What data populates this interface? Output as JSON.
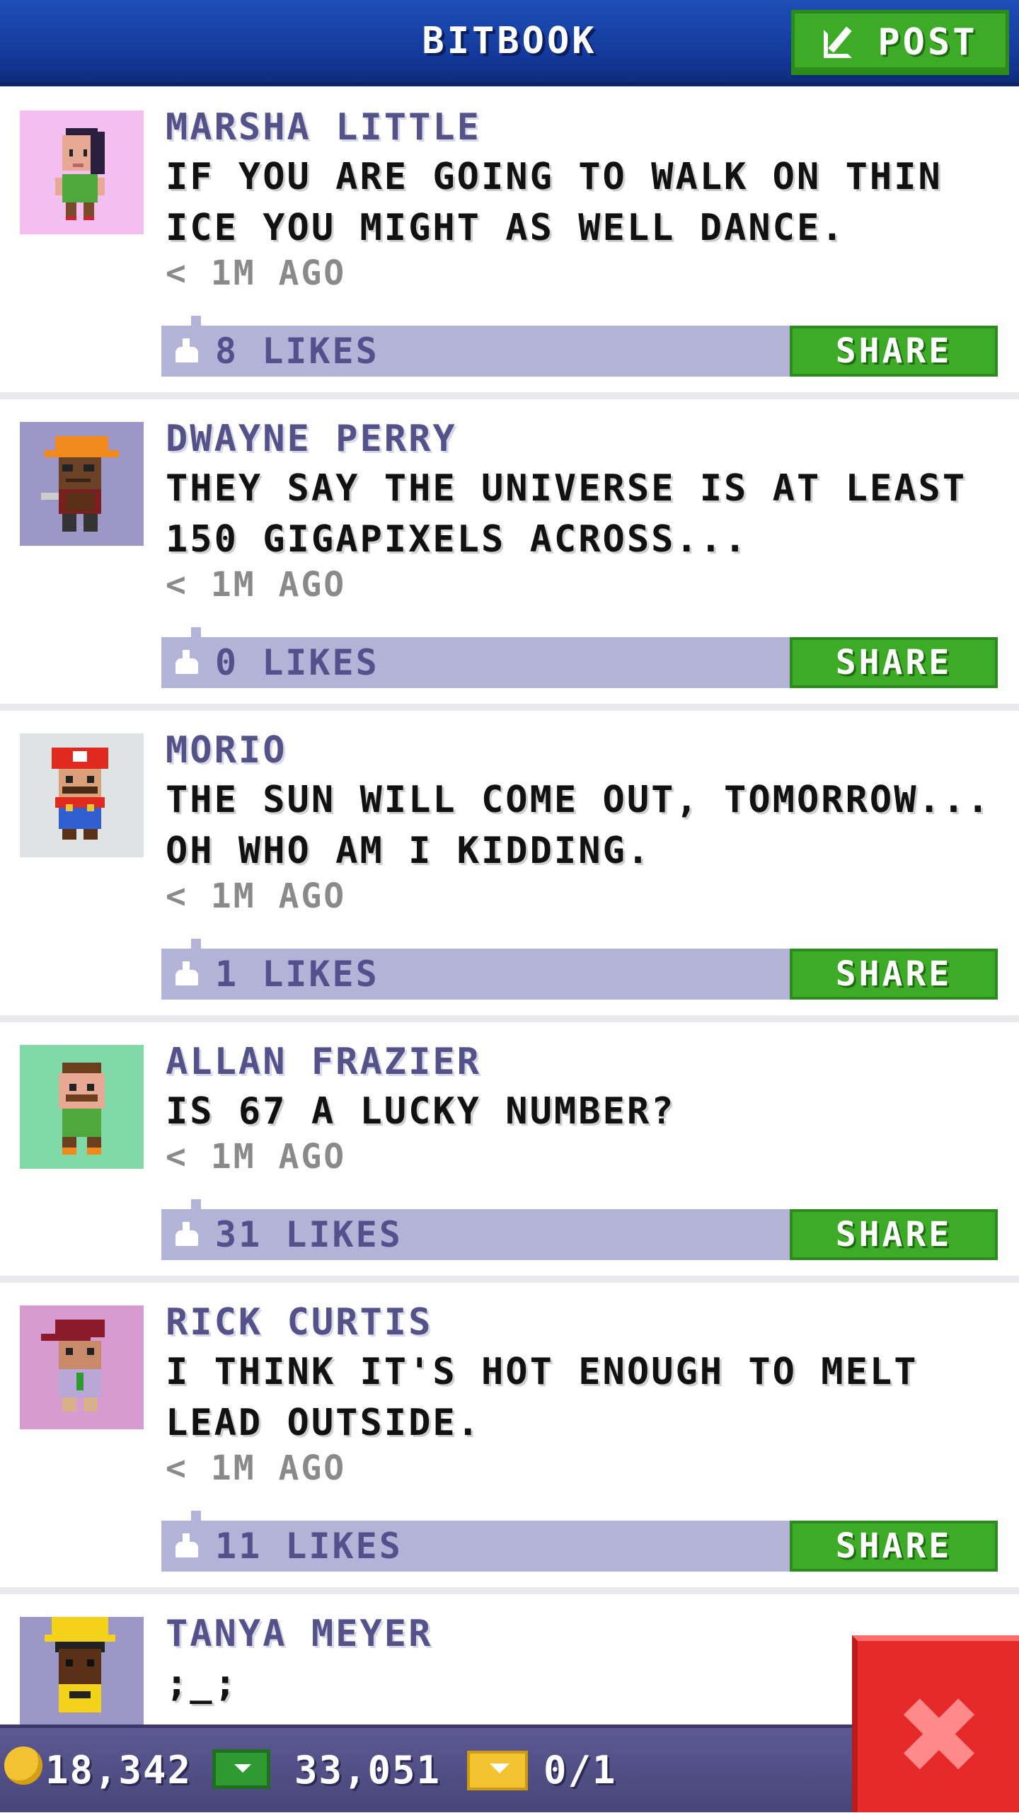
{
  "app": {
    "title": "BITBOOK",
    "post_label": "POST"
  },
  "posts": [
    {
      "name": "MARSHA LITTLE",
      "message": "IF YOU ARE GOING TO WALK ON THIN ICE YOU MIGHT AS WELL DANCE.",
      "time": "< 1M AGO",
      "likes": "8 LIKES",
      "share": "SHARE",
      "avatar_bg": "#f2bff0",
      "avatar": "woman-green-shirt"
    },
    {
      "name": "DWAYNE PERRY",
      "message": "THEY SAY THE UNIVERSE IS AT LEAST 150 GIGAPIXELS ACROSS...",
      "time": "< 1M AGO",
      "likes": "0 LIKES",
      "share": "SHARE",
      "avatar_bg": "#9d97c7",
      "avatar": "construction-worker"
    },
    {
      "name": "MORIO",
      "message": "THE SUN WILL COME OUT, TOMORROW... OH WHO AM I KIDDING.",
      "time": "< 1M AGO",
      "likes": "1 LIKES",
      "share": "SHARE",
      "avatar_bg": "#dfe3e4",
      "avatar": "plumber-red-cap"
    },
    {
      "name": "ALLAN FRAZIER",
      "message": "IS 67 A LUCKY NUMBER?",
      "time": "< 1M AGO",
      "likes": "31 LIKES",
      "share": "SHARE",
      "avatar_bg": "#80d9a6",
      "avatar": "man-mustache-green"
    },
    {
      "name": "RICK CURTIS",
      "message": "I THINK IT'S HOT ENOUGH TO MELT LEAD OUTSIDE.",
      "time": "< 1M AGO",
      "likes": "11 LIKES",
      "share": "SHARE",
      "avatar_bg": "#d79ad1",
      "avatar": "man-red-cap"
    },
    {
      "name": "TANYA MEYER",
      "message": ";_;",
      "avatar_bg": "#9d97c7",
      "avatar": "yellow-hat"
    }
  ],
  "status": {
    "coins": "18,342",
    "bux": "33,051",
    "tickets": "0/1"
  },
  "colors": {
    "header": "#1d4fb6",
    "accent_green": "#3daa28",
    "name_purple": "#55528a",
    "like_bar": "#b3b3d8",
    "close_red": "#e62a2a"
  }
}
